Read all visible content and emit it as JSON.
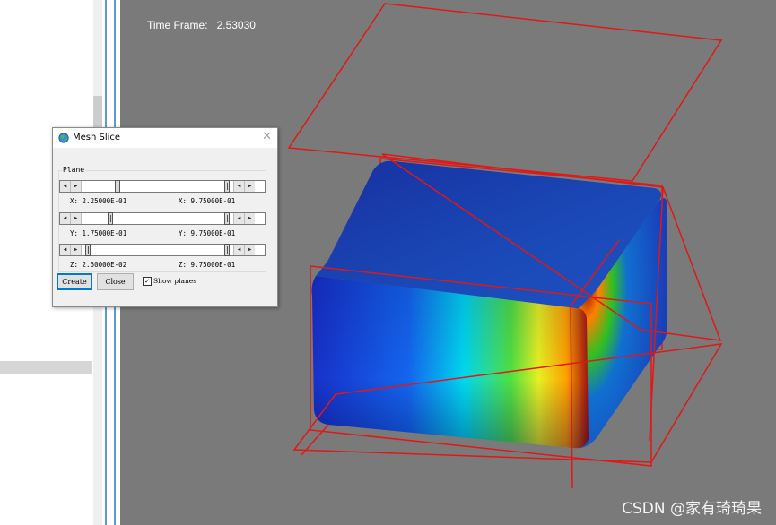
{
  "viewport": {
    "time_frame_label": "Time Frame:",
    "time_frame_value": "2.53030",
    "watermark": "CSDN @家有琦琦果"
  },
  "dialog": {
    "title": "Mesh Slice",
    "close_icon": "close-icon",
    "plane_group_label": "Plane",
    "sliders": [
      {
        "axis": "X",
        "min_label": "X: 2.25000E-01",
        "max_label": "X: 9.75000E-01",
        "min_fraction": 0.225,
        "max_fraction": 0.975
      },
      {
        "axis": "Y",
        "min_label": "Y: 1.75000E-01",
        "max_label": "Y: 9.75000E-01",
        "min_fraction": 0.175,
        "max_fraction": 0.975
      },
      {
        "axis": "Z",
        "min_label": "Z: 2.50000E-02",
        "max_label": "Z: 9.75000E-01",
        "min_fraction": 0.025,
        "max_fraction": 0.975
      }
    ],
    "create_label": "Create",
    "close_label": "Close",
    "show_planes_label": "Show planes",
    "show_planes_checked": true
  },
  "colors": {
    "viewport_bg": "#7a7a7a",
    "slice_plane": "#e01818",
    "accent": "#0078d7"
  }
}
